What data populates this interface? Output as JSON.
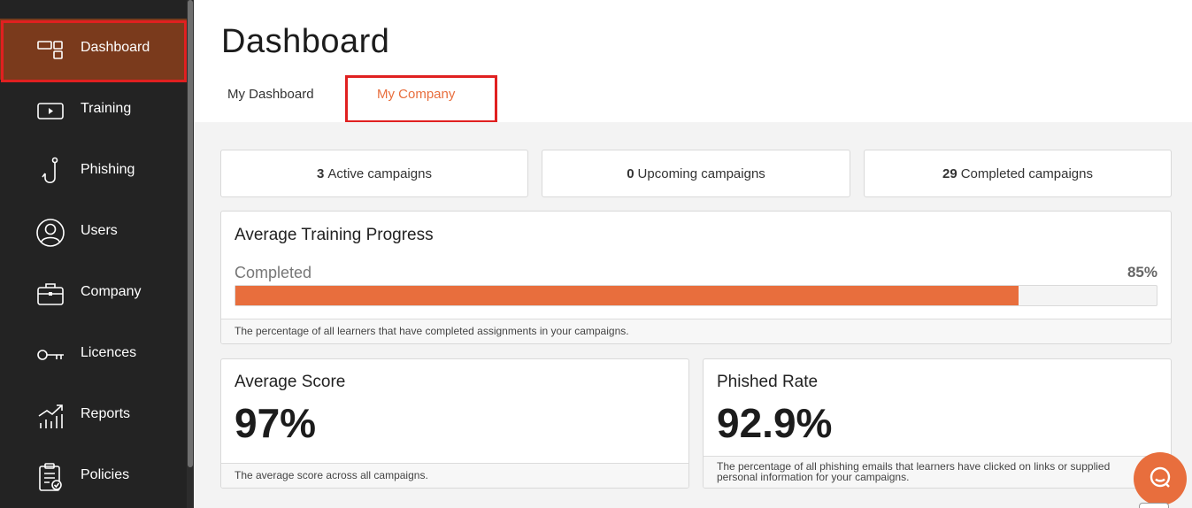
{
  "sidebar": {
    "items": [
      {
        "label": "Dashboard",
        "icon": "dashboard-icon",
        "active": true
      },
      {
        "label": "Training",
        "icon": "play-video-icon"
      },
      {
        "label": "Phishing",
        "icon": "fish-hook-icon"
      },
      {
        "label": "Users",
        "icon": "user-circle-icon"
      },
      {
        "label": "Company",
        "icon": "briefcase-icon"
      },
      {
        "label": "Licences",
        "icon": "key-icon"
      },
      {
        "label": "Reports",
        "icon": "growth-chart-icon"
      },
      {
        "label": "Policies",
        "icon": "clipboard-check-icon"
      }
    ]
  },
  "header": {
    "title": "Dashboard",
    "tabs": [
      {
        "label": "My Dashboard"
      },
      {
        "label": "My Company",
        "active": true
      }
    ]
  },
  "stats": [
    {
      "count": "3",
      "label": "Active campaigns"
    },
    {
      "count": "0",
      "label": "Upcoming campaigns"
    },
    {
      "count": "29",
      "label": "Completed campaigns"
    }
  ],
  "training_progress": {
    "title": "Average Training Progress",
    "label": "Completed",
    "percent_text": "85%",
    "percent": 85,
    "footer": "The percentage of all learners that have completed assignments in your campaigns."
  },
  "average_score": {
    "title": "Average Score",
    "value": "97%",
    "footer": "The average score across all campaigns."
  },
  "phished_rate": {
    "title": "Phished Rate",
    "value": "92.9%",
    "footer": "The percentage of all phishing emails that learners have clicked on links or supplied personal information for your campaigns."
  },
  "colors": {
    "accent": "#e86e3d",
    "sidebar_bg": "#232323",
    "sidebar_active": "#7a3a1c",
    "highlight": "#e02020"
  }
}
